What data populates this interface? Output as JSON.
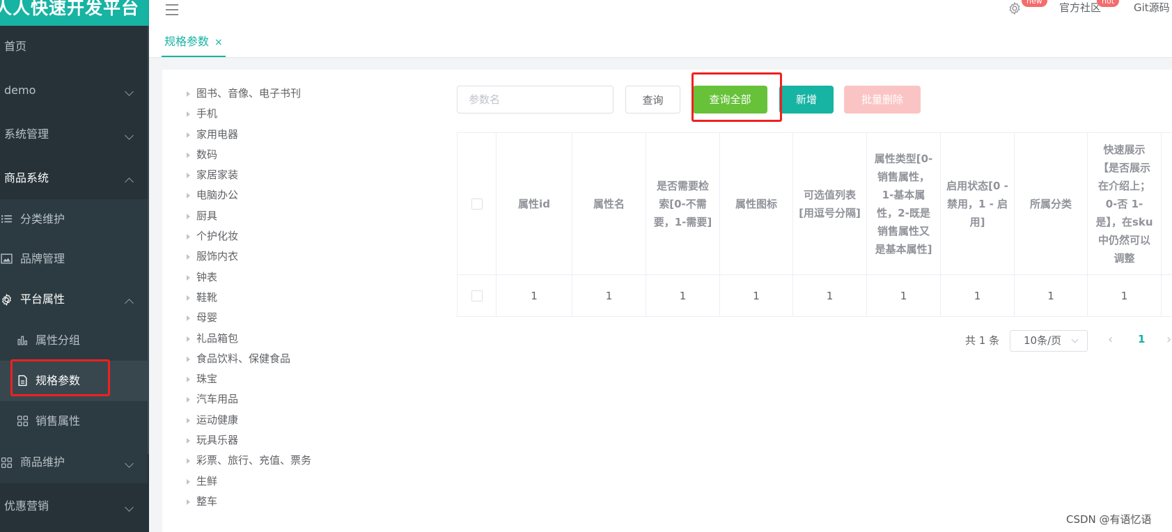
{
  "app": {
    "title": "人人快速开发平台"
  },
  "topbar": {
    "items": [
      {
        "label": "",
        "badge": "new"
      },
      {
        "label": "官方社区",
        "badge": "hot"
      },
      {
        "label": "Git源码",
        "badge": ""
      }
    ]
  },
  "sidebar": {
    "items": [
      {
        "label": "首页"
      },
      {
        "label": "demo"
      },
      {
        "label": "系统管理"
      },
      {
        "label": "商品系统"
      },
      {
        "label": "分类维护"
      },
      {
        "label": "品牌管理"
      },
      {
        "label": "平台属性"
      },
      {
        "label": "属性分组"
      },
      {
        "label": "规格参数"
      },
      {
        "label": "销售属性"
      },
      {
        "label": "商品维护"
      },
      {
        "label": "优惠营销"
      }
    ]
  },
  "tabs": [
    {
      "label": "规格参数",
      "close": "×"
    }
  ],
  "tree": [
    "图书、音像、电子书刊",
    "手机",
    "家用电器",
    "数码",
    "家居家装",
    "电脑办公",
    "厨具",
    "个护化妆",
    "服饰内衣",
    "钟表",
    "鞋靴",
    "母婴",
    "礼品箱包",
    "食品饮料、保健食品",
    "珠宝",
    "汽车用品",
    "运动健康",
    "玩具乐器",
    "彩票、旅行、充值、票务",
    "生鲜",
    "整车"
  ],
  "toolbar": {
    "search_placeholder": "参数名",
    "search_value": "",
    "query_label": "查询",
    "query_all_label": "查询全部",
    "add_label": "新增",
    "batch_delete_label": "批量删除"
  },
  "table": {
    "headers": [
      "属性id",
      "属性名",
      "是否需要检索[0-不需要，1-需要]",
      "属性图标",
      "可选值列表[用逗号分隔]",
      "属性类型[0-销售属性，1-基本属性，2-既是销售属性又是基本属性]",
      "启用状态[0 - 禁用，1 - 启用]",
      "所属分类",
      "快速展示【是否展示在介绍上；0-否 1-是】，在sku中仍然可以调整"
    ],
    "rows": [
      [
        "1",
        "1",
        "1",
        "1",
        "1",
        "1",
        "1",
        "1",
        "1"
      ]
    ]
  },
  "pagination": {
    "total": "共 1 条",
    "page_size": "10条/页",
    "current_page": "1",
    "prev": "‹",
    "next": "›"
  },
  "watermark": "CSDN @有语忆语",
  "colors": {
    "primary": "#17b3a3",
    "success": "#67c23a",
    "danger_light": "#fbc4c4",
    "sidebar": "#263238",
    "highlight": "#f02020"
  }
}
